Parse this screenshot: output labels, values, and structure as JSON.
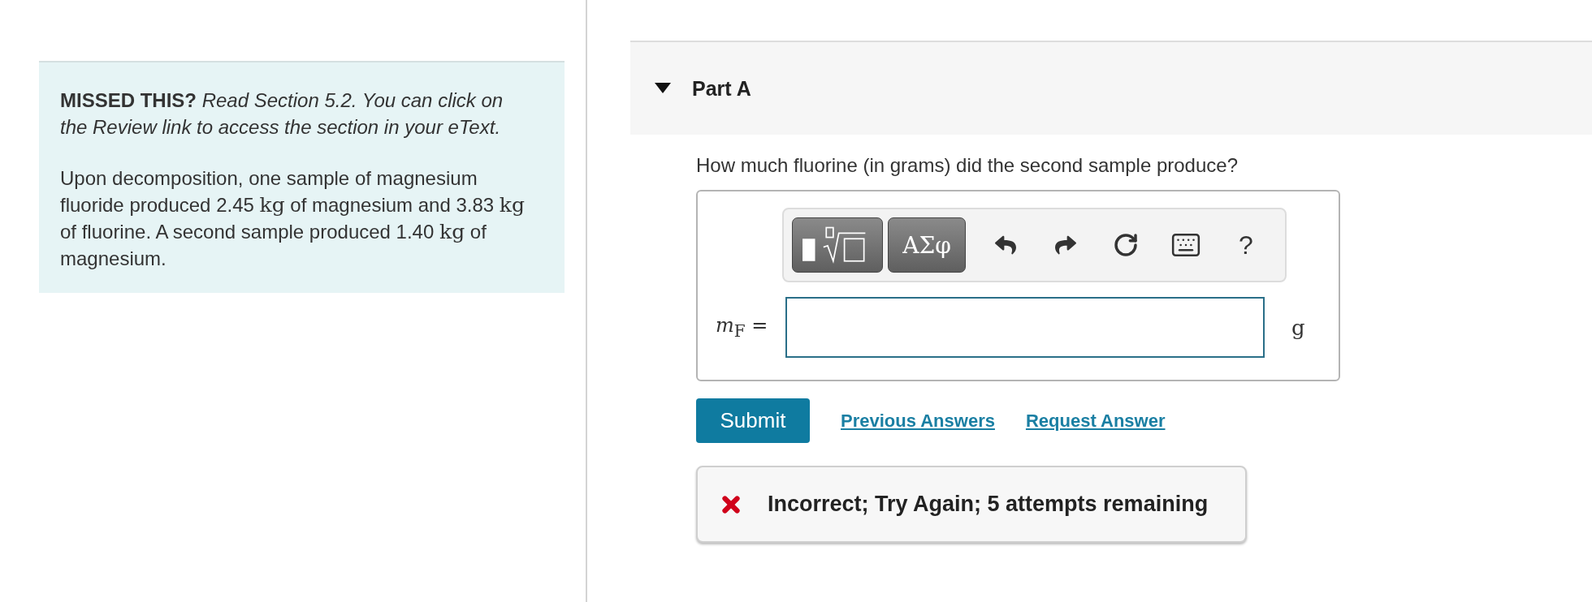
{
  "intro": {
    "text": "**MISSED THIS?** *Read Section 5.2. You can click on the Review link to access the section in your eText.*"
  },
  "problem": {
    "segments": [
      {
        "kind": "text",
        "text": "Upon decomposition, one sample of magnesium fluoride produced 2.45 "
      },
      {
        "kind": "unit",
        "text": "kg"
      },
      {
        "kind": "text",
        "text": " of magnesium and 3.83 "
      },
      {
        "kind": "unit",
        "text": "kg"
      },
      {
        "kind": "text",
        "text": " of fluorine. A second sample produced 1.40 "
      },
      {
        "kind": "unit",
        "text": "kg"
      },
      {
        "kind": "text",
        "text": " of magnesium."
      }
    ]
  },
  "part": {
    "title": "Part A",
    "expanded": true
  },
  "question": "How much fluorine (in grams) did the second sample produce?",
  "toolbar": [
    {
      "kind": "templates"
    },
    {
      "kind": "symbols",
      "label": "ΑΣφ"
    },
    {
      "kind": "undo"
    },
    {
      "kind": "redo"
    },
    {
      "kind": "reset"
    },
    {
      "kind": "keyboard"
    },
    {
      "kind": "help",
      "label": "?"
    }
  ],
  "answer": {
    "label": "*m*$_{F}$ =",
    "unit": "g"
  },
  "actions": {
    "submit": "Submit",
    "links": [
      "Previous Answers",
      "Request Answer"
    ]
  },
  "feedback": {
    "correct": false,
    "text": "Incorrect; Try Again; 5 attempts remaining"
  }
}
